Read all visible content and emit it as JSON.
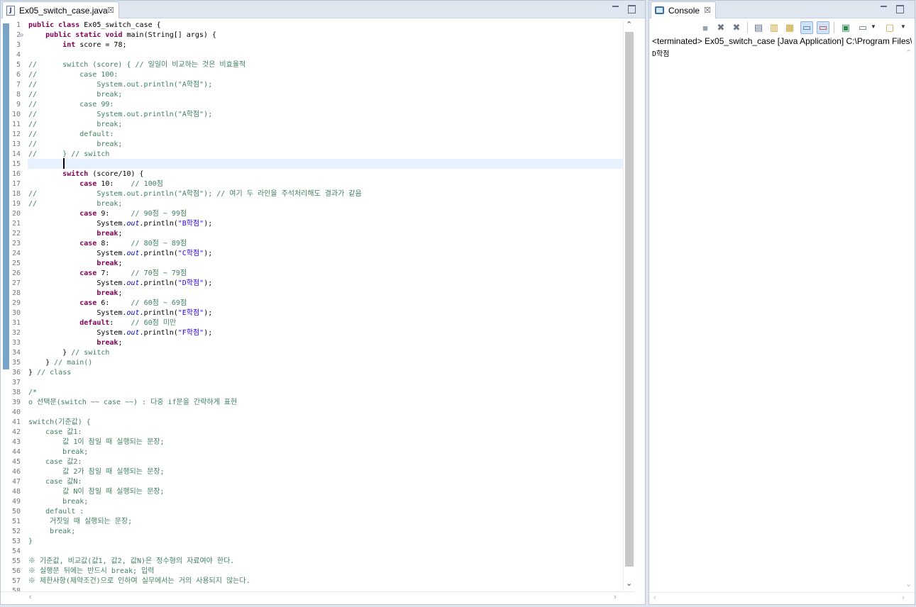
{
  "editor": {
    "tab_title": "Ex05_switch_case.java",
    "tab_close": "☒",
    "lines": [
      {
        "n": "1",
        "segs": [
          [
            "kw",
            "public class "
          ],
          [
            "",
            "Ex05_switch_case {"
          ]
        ]
      },
      {
        "n": "2",
        "fold": true,
        "segs": [
          [
            "",
            "    "
          ],
          [
            "kw",
            "public static void "
          ],
          [
            "",
            "main(String[] args) {"
          ]
        ]
      },
      {
        "n": "3",
        "segs": [
          [
            "",
            "        "
          ],
          [
            "kw",
            "int "
          ],
          [
            "",
            "score = 78;"
          ]
        ]
      },
      {
        "n": "4",
        "segs": []
      },
      {
        "n": "5",
        "segs": [
          [
            "cm",
            "//      switch (score) { // 일일이 비교하는 것은 비효율적"
          ]
        ]
      },
      {
        "n": "6",
        "segs": [
          [
            "cm",
            "//          case 100:"
          ]
        ]
      },
      {
        "n": "7",
        "segs": [
          [
            "cm",
            "//              System.out.println(\"A학점\");"
          ]
        ]
      },
      {
        "n": "8",
        "segs": [
          [
            "cm",
            "//              break;"
          ]
        ]
      },
      {
        "n": "9",
        "segs": [
          [
            "cm",
            "//          case 99:"
          ]
        ]
      },
      {
        "n": "10",
        "segs": [
          [
            "cm",
            "//              System.out.println(\"A학점\");"
          ]
        ]
      },
      {
        "n": "11",
        "segs": [
          [
            "cm",
            "//              break;"
          ]
        ]
      },
      {
        "n": "12",
        "segs": [
          [
            "cm",
            "//          default:"
          ]
        ]
      },
      {
        "n": "13",
        "segs": [
          [
            "cm",
            "//              break;"
          ]
        ]
      },
      {
        "n": "14",
        "segs": [
          [
            "cm",
            "//      } // switch"
          ]
        ]
      },
      {
        "n": "15",
        "segs": []
      },
      {
        "n": "16",
        "segs": [
          [
            "",
            "        "
          ],
          [
            "kw",
            "switch "
          ],
          [
            "",
            "(score/10) {"
          ]
        ]
      },
      {
        "n": "17",
        "segs": [
          [
            "",
            "            "
          ],
          [
            "kw",
            "case "
          ],
          [
            "",
            "10:    "
          ],
          [
            "cm",
            "// 100점"
          ]
        ]
      },
      {
        "n": "18",
        "segs": [
          [
            "cm",
            "//              System.out.println(\"A학점\"); // 여기 두 라인을 주석처리해도 결과가 같음"
          ]
        ]
      },
      {
        "n": "19",
        "segs": [
          [
            "cm",
            "//              break;"
          ]
        ]
      },
      {
        "n": "20",
        "segs": [
          [
            "",
            "            "
          ],
          [
            "kw",
            "case "
          ],
          [
            "",
            "9:     "
          ],
          [
            "cm",
            "// 90점 ~ 99점"
          ]
        ]
      },
      {
        "n": "21",
        "segs": [
          [
            "",
            "                System."
          ],
          [
            "fld",
            "out"
          ],
          [
            "",
            ".println("
          ],
          [
            "str",
            "\"B학점\""
          ],
          [
            "",
            ");"
          ]
        ]
      },
      {
        "n": "22",
        "segs": [
          [
            "",
            "                "
          ],
          [
            "kw",
            "break"
          ],
          [
            "",
            ";"
          ]
        ]
      },
      {
        "n": "23",
        "segs": [
          [
            "",
            "            "
          ],
          [
            "kw",
            "case "
          ],
          [
            "",
            "8:     "
          ],
          [
            "cm",
            "// 80점 ~ 89점"
          ]
        ]
      },
      {
        "n": "24",
        "segs": [
          [
            "",
            "                System."
          ],
          [
            "fld",
            "out"
          ],
          [
            "",
            ".println("
          ],
          [
            "str",
            "\"C학점\""
          ],
          [
            "",
            ");"
          ]
        ]
      },
      {
        "n": "25",
        "segs": [
          [
            "",
            "                "
          ],
          [
            "kw",
            "break"
          ],
          [
            "",
            ";"
          ]
        ]
      },
      {
        "n": "26",
        "segs": [
          [
            "",
            "            "
          ],
          [
            "kw",
            "case "
          ],
          [
            "",
            "7:     "
          ],
          [
            "cm",
            "// 70점 ~ 79점"
          ]
        ]
      },
      {
        "n": "27",
        "segs": [
          [
            "",
            "                System."
          ],
          [
            "fld",
            "out"
          ],
          [
            "",
            ".println("
          ],
          [
            "str",
            "\"D학점\""
          ],
          [
            "",
            ");"
          ]
        ]
      },
      {
        "n": "28",
        "segs": [
          [
            "",
            "                "
          ],
          [
            "kw",
            "break"
          ],
          [
            "",
            ";"
          ]
        ]
      },
      {
        "n": "29",
        "segs": [
          [
            "",
            "            "
          ],
          [
            "kw",
            "case "
          ],
          [
            "",
            "6:     "
          ],
          [
            "cm",
            "// 60점 ~ 69점"
          ]
        ]
      },
      {
        "n": "30",
        "segs": [
          [
            "",
            "                System."
          ],
          [
            "fld",
            "out"
          ],
          [
            "",
            ".println("
          ],
          [
            "str",
            "\"E학점\""
          ],
          [
            "",
            ");"
          ]
        ]
      },
      {
        "n": "31",
        "segs": [
          [
            "",
            "            "
          ],
          [
            "kw",
            "default"
          ],
          [
            "",
            ":    "
          ],
          [
            "cm",
            "// 60점 미만"
          ]
        ]
      },
      {
        "n": "32",
        "segs": [
          [
            "",
            "                System."
          ],
          [
            "fld",
            "out"
          ],
          [
            "",
            ".println("
          ],
          [
            "str",
            "\"F학점\""
          ],
          [
            "",
            ");"
          ]
        ]
      },
      {
        "n": "33",
        "segs": [
          [
            "",
            "                "
          ],
          [
            "kw",
            "break"
          ],
          [
            "",
            ";"
          ]
        ]
      },
      {
        "n": "34",
        "segs": [
          [
            "",
            "        } "
          ],
          [
            "cm",
            "// switch"
          ]
        ]
      },
      {
        "n": "35",
        "segs": [
          [
            "",
            "    } "
          ],
          [
            "cm",
            "// main()"
          ]
        ]
      },
      {
        "n": "36",
        "segs": [
          [
            "",
            "} "
          ],
          [
            "cm",
            "// class"
          ]
        ]
      },
      {
        "n": "37",
        "segs": []
      },
      {
        "n": "38",
        "segs": [
          [
            "cm",
            "/*"
          ]
        ]
      },
      {
        "n": "39",
        "segs": [
          [
            "cm",
            "o 선택문(switch ~~ case ~~) : 다중 if문을 간략하게 표현"
          ]
        ]
      },
      {
        "n": "40",
        "segs": []
      },
      {
        "n": "41",
        "segs": [
          [
            "cm",
            "switch(기준값) {"
          ]
        ]
      },
      {
        "n": "42",
        "segs": [
          [
            "cm",
            "    case 값1:"
          ]
        ]
      },
      {
        "n": "43",
        "segs": [
          [
            "cm",
            "        값 1이 참일 때 실행되는 문장;"
          ]
        ]
      },
      {
        "n": "44",
        "segs": [
          [
            "cm",
            "        break;"
          ]
        ]
      },
      {
        "n": "45",
        "segs": [
          [
            "cm",
            "    case 값2:"
          ]
        ]
      },
      {
        "n": "46",
        "segs": [
          [
            "cm",
            "        값 2가 참일 때 실행되는 문장;"
          ]
        ]
      },
      {
        "n": "47",
        "segs": [
          [
            "cm",
            "    case 값N:"
          ]
        ]
      },
      {
        "n": "48",
        "segs": [
          [
            "cm",
            "        값 N이 참일 때 실행되는 문장;"
          ]
        ]
      },
      {
        "n": "49",
        "segs": [
          [
            "cm",
            "        break;"
          ]
        ]
      },
      {
        "n": "50",
        "segs": [
          [
            "cm",
            "    default :"
          ]
        ]
      },
      {
        "n": "51",
        "segs": [
          [
            "cm",
            "     거짓일 때 실행되는 문장;"
          ]
        ]
      },
      {
        "n": "52",
        "segs": [
          [
            "cm",
            "     break;"
          ]
        ]
      },
      {
        "n": "53",
        "segs": [
          [
            "cm",
            "}"
          ]
        ]
      },
      {
        "n": "54",
        "segs": []
      },
      {
        "n": "55",
        "segs": [
          [
            "cm",
            "※ 기준값, 비교값(값1, 값2, 값N)은 정수형의 자료여야 한다."
          ]
        ]
      },
      {
        "n": "56",
        "segs": [
          [
            "cm",
            "※ 실행문 뒤에는 반드시 break; 입력"
          ]
        ]
      },
      {
        "n": "57",
        "segs": [
          [
            "cm",
            "※ 제한사항(제약조건)으로 인하여 실무에서는 거의 사용되지 않는다."
          ]
        ]
      },
      {
        "n": "58",
        "segs": []
      }
    ]
  },
  "console": {
    "tab_title": "Console",
    "tab_close": "☒",
    "status_line": "<terminated> Ex05_switch_case [Java Application] C:\\Program Files\\",
    "output": "D학점",
    "toolbar": {
      "terminate": "■",
      "remove_launch": "✖",
      "remove_all": "✖",
      "clear_console": "▤",
      "scroll_lock": "▥",
      "word_wrap": "▦",
      "show_on_stdout": "▭",
      "show_on_stderr": "▭",
      "pin_console": "▣",
      "display_selected": "▭",
      "open_console": "▢",
      "dropdown": "▼"
    }
  },
  "scroll": {
    "up": "⌃",
    "down": "⌄",
    "left": "‹",
    "right": "›"
  }
}
